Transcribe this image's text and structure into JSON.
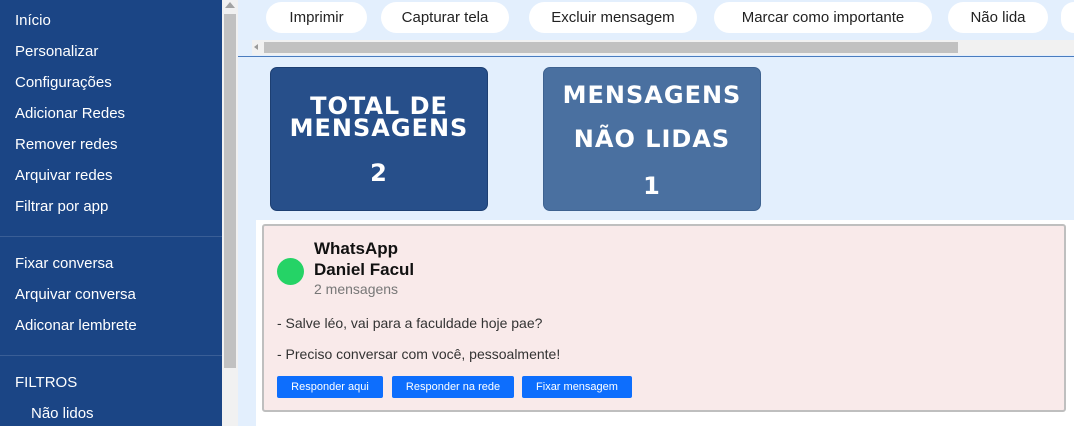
{
  "sidebar": {
    "items": [
      {
        "label": "Início"
      },
      {
        "label": "Personalizar"
      },
      {
        "label": "Configurações"
      },
      {
        "label": "Adicionar Redes"
      },
      {
        "label": "Remover redes"
      },
      {
        "label": "Arquivar redes"
      },
      {
        "label": "Filtrar por app"
      },
      {
        "label": "Fixar conversa"
      },
      {
        "label": "Arquivar conversa"
      },
      {
        "label": "Adiconar lembrete"
      }
    ],
    "filters_heading": "FILTROS",
    "filters": [
      {
        "label": "Não lidos"
      }
    ]
  },
  "toolbar": {
    "buttons": [
      "Imprimir",
      "Capturar tela",
      "Excluir mensagem",
      "Marcar como importante",
      "Não lida"
    ]
  },
  "stats": {
    "total": {
      "title_line1": "TOTAL DE",
      "title_line2": "MENSAGENS",
      "value": "2"
    },
    "unread": {
      "title_line1": "MENSAGENS",
      "title_line2": "NÃO LIDAS",
      "value": "1"
    }
  },
  "message": {
    "app": "WhatsApp",
    "app_color": "#25d366",
    "contact": "Daniel Facul",
    "count": "2 mensagens",
    "lines": [
      "- Salve léo, vai para a faculdade hoje pae?",
      "- Preciso conversar com você, pessoalmente!"
    ],
    "actions": [
      "Responder aqui",
      "Responder na rede",
      "Fixar mensagem"
    ]
  },
  "colors": {
    "sidebar_bg": "#1b4585",
    "main_bg": "#e3effd",
    "card_total": "#274f8a",
    "card_unread": "#4a70a0",
    "action_button": "#0d6efd",
    "message_bg": "#f9eaea"
  }
}
